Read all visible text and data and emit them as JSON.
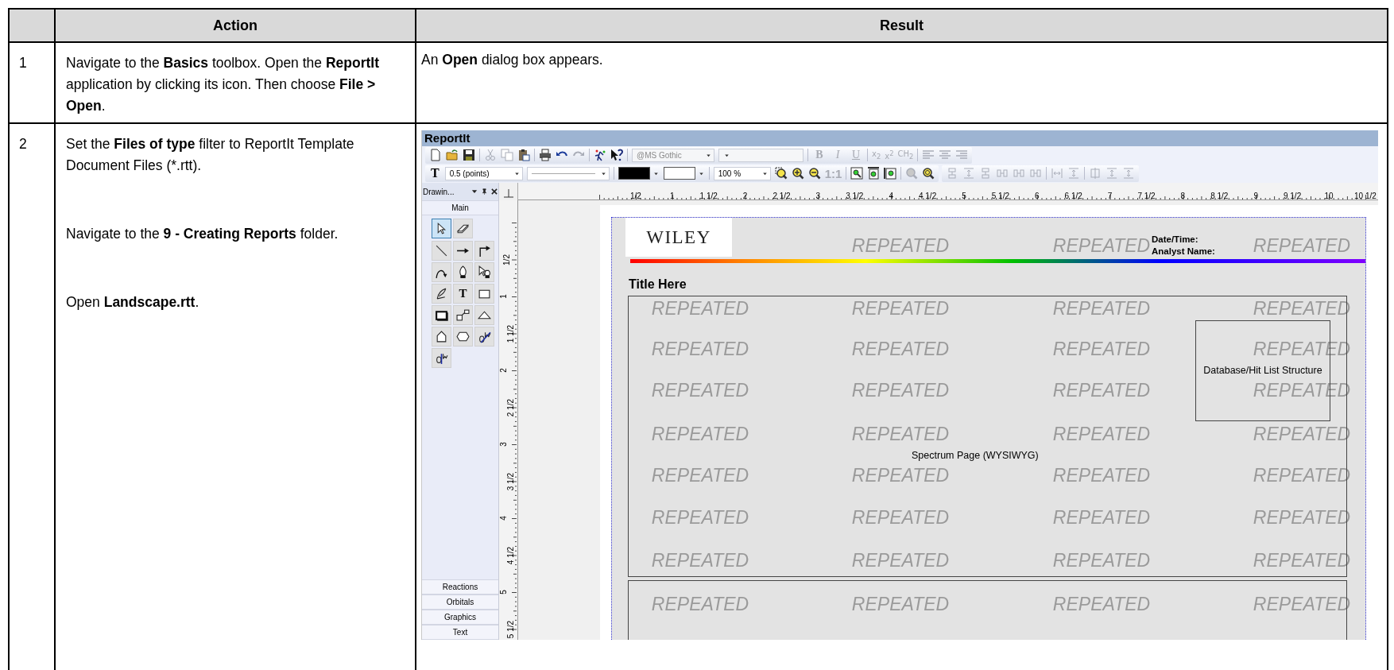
{
  "table": {
    "columns": [
      {
        "label": "Action"
      },
      {
        "label": "Result"
      }
    ],
    "rows": [
      {
        "number": "1",
        "action": [
          "Navigate to the **Basics** toolbox. Open the **ReportIt** application by clicking its icon. Then choose **File > Open**."
        ],
        "result": {
          "kind": "text",
          "text": "An **Open** dialog box appears."
        }
      },
      {
        "number": "2",
        "action": [
          "Set the **Files of type** filter to ReportIt Template Document Files (*.rtt).",
          "Navigate to the **9 - Creating Reports** folder.",
          "Open **Landscape.rtt**."
        ],
        "result": {
          "kind": "screenshot"
        }
      }
    ]
  },
  "app": {
    "title": "ReportIt",
    "font_box": {
      "value": "@MS Gothic",
      "disabled": true
    },
    "format_buttons": [
      {
        "label": "B",
        "disabled": true
      },
      {
        "label": "I",
        "disabled": true
      },
      {
        "label": "U",
        "disabled": true
      },
      {
        "label": "x$_{2}$",
        "disabled": true
      },
      {
        "label": "x$^{2}$",
        "disabled": true
      },
      {
        "label": "CH$_{2}$",
        "disabled": true
      }
    ],
    "text_tool": "T",
    "line_width": "0.5 (points)",
    "color_pickers": [
      {
        "color": "#000000"
      },
      {
        "color": "#ffffff"
      }
    ],
    "zoom": "100 %",
    "actual_size_button": {
      "label": "1:1",
      "disabled": true
    },
    "ruler_h": [
      "1/2",
      "1",
      "1 1/2",
      "2",
      "2 1/2",
      "3",
      "3 1/2",
      "4",
      "4 1/2",
      "5",
      "5 1/2",
      "6",
      "6 1/2",
      "7",
      "7 1/2",
      "8",
      "8 1/2",
      "9",
      "9 1/2",
      "10",
      "10 1/2"
    ],
    "ruler_v": [
      "1/2",
      "1",
      "1 1/2",
      "2",
      "2 1/2",
      "3",
      "3 1/2",
      "4",
      "4 1/2",
      "5",
      "5 1/2"
    ],
    "panel": {
      "title": "Drawin...",
      "sections": [
        {
          "label": "Main",
          "expanded": true
        },
        {
          "label": "Reactions",
          "expanded": false
        },
        {
          "label": "Orbitals",
          "expanded": false
        },
        {
          "label": "Graphics",
          "expanded": false
        },
        {
          "label": "Text",
          "expanded": false
        }
      ],
      "tool_groups": [
        [
          {
            "kind": "pointer",
            "selected": true
          },
          {
            "kind": "eraser",
            "selected": false
          }
        ],
        [
          {
            "kind": "line",
            "selected": false
          },
          {
            "kind": "arrow",
            "selected": false
          },
          {
            "kind": "elbow",
            "selected": false
          },
          {
            "kind": "arc",
            "selected": false
          },
          {
            "kind": "pen",
            "selected": false
          },
          {
            "kind": "penpointer",
            "selected": false
          },
          {
            "kind": "feather",
            "selected": false
          },
          {
            "kind": "text",
            "label": "T",
            "selected": false
          },
          {
            "kind": "rectangle",
            "selected": false
          },
          {
            "kind": "shadowbox",
            "selected": false
          },
          {
            "kind": "linked",
            "selected": false
          },
          {
            "kind": "triangle",
            "selected": false
          },
          {
            "kind": "pentagon",
            "selected": false
          },
          {
            "kind": "hexagon",
            "selected": false
          },
          {
            "kind": "crossed",
            "selected": false
          },
          {
            "kind": "hooked",
            "selected": false
          }
        ]
      ]
    },
    "page": {
      "logo": "WILEY",
      "header_fields": [
        "Date/Time:",
        "Analyst Name:"
      ],
      "title": "Title Here",
      "watermark_rows": [
        [
          "REPEATED",
          "REPEATED",
          "REPEATED"
        ],
        [
          "REPEATED",
          "REPEATED",
          "REPEATED",
          "REPEATED"
        ],
        [
          "REPEATED",
          "REPEATED",
          "REPEATED",
          "REPEATED"
        ],
        [
          "REPEATED",
          "REPEATED",
          "REPEATED",
          "REPEATED"
        ],
        [
          "REPEATED",
          "REPEATED",
          "REPEATED",
          "REPEATED"
        ],
        [
          "REPEATED",
          "REPEATED",
          "REPEATED",
          "REPEATED"
        ],
        [
          "REPEATED",
          "REPEATED",
          "REPEATED",
          "REPEATED"
        ],
        [
          "REPEATED",
          "REPEATED",
          "REPEATED",
          "REPEATED"
        ],
        [
          "REPEATED",
          "REPEATED",
          "REPEATED",
          "REPEATED"
        ]
      ],
      "spectrum_label": "Spectrum Page (WYSIWYG)",
      "structure_label": "Database/Hit List Structure"
    }
  }
}
